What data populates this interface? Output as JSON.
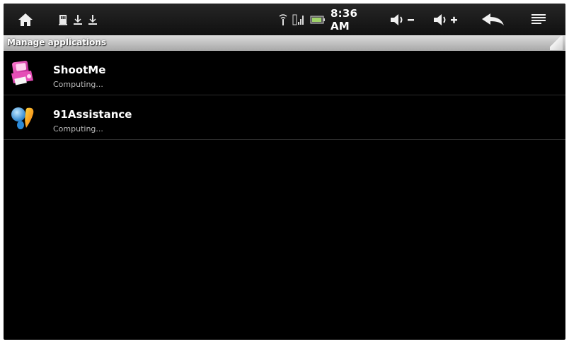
{
  "status_bar": {
    "time": "8:36 AM",
    "icons": [
      "home-icon",
      "notification-icons",
      "wifi-icon",
      "signal-icon",
      "battery-icon",
      "volume-down-icon",
      "volume-up-icon",
      "back-icon",
      "menu-icon"
    ]
  },
  "header": {
    "title": "Manage applications"
  },
  "apps": [
    {
      "name": "ShootMe",
      "status": "Computing...",
      "icon": "shootme-app-icon"
    },
    {
      "name": "91Assistance",
      "status": "Computing...",
      "icon": "91assistance-app-icon"
    }
  ],
  "colors": {
    "background": "#000000",
    "title_strip": "#bdbdbd",
    "text_primary": "#ffffff",
    "text_secondary": "#bdbdbd"
  }
}
